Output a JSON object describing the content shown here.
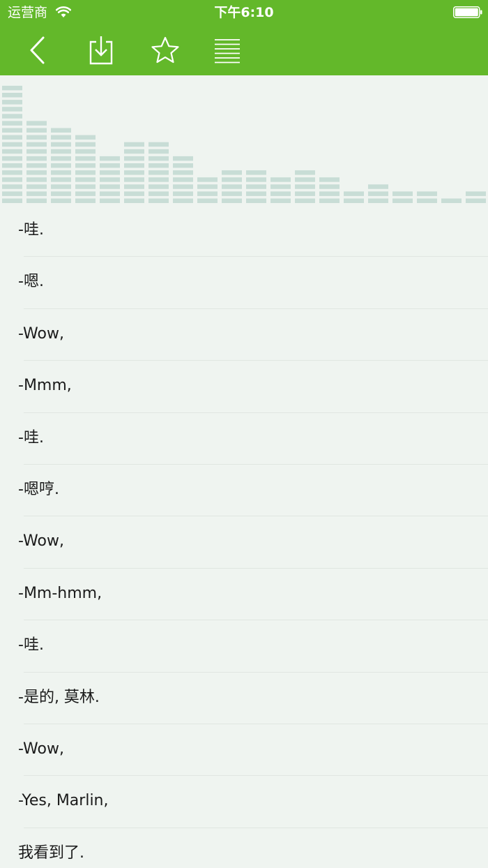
{
  "status_bar": {
    "carrier": "运营商",
    "time": "下午6:10"
  },
  "toolbar": {
    "icons": [
      "back-chevron-icon",
      "download-icon",
      "star-icon",
      "list-icon"
    ]
  },
  "visualizer": {
    "bar_levels": [
      17,
      12,
      11,
      10,
      7,
      9,
      9,
      7,
      4,
      5,
      5,
      4,
      5,
      4,
      2,
      3,
      2,
      2,
      1,
      2
    ],
    "segment_color": "#c8ddd6"
  },
  "colors": {
    "header": "#63b82a",
    "background": "#eff4f0"
  },
  "subtitles": [
    {
      "text": "-哇."
    },
    {
      "text": "-嗯."
    },
    {
      "text": "-Wow,"
    },
    {
      "text": "-Mmm,"
    },
    {
      "text": "-哇."
    },
    {
      "text": "-嗯哼."
    },
    {
      "text": "-Wow,"
    },
    {
      "text": "-Mm-hmm,"
    },
    {
      "text": "-哇."
    },
    {
      "text": "-是的, 莫林."
    },
    {
      "text": "-Wow,"
    },
    {
      "text": "-Yes, Marlin,"
    },
    {
      "text": "我看到了."
    }
  ]
}
